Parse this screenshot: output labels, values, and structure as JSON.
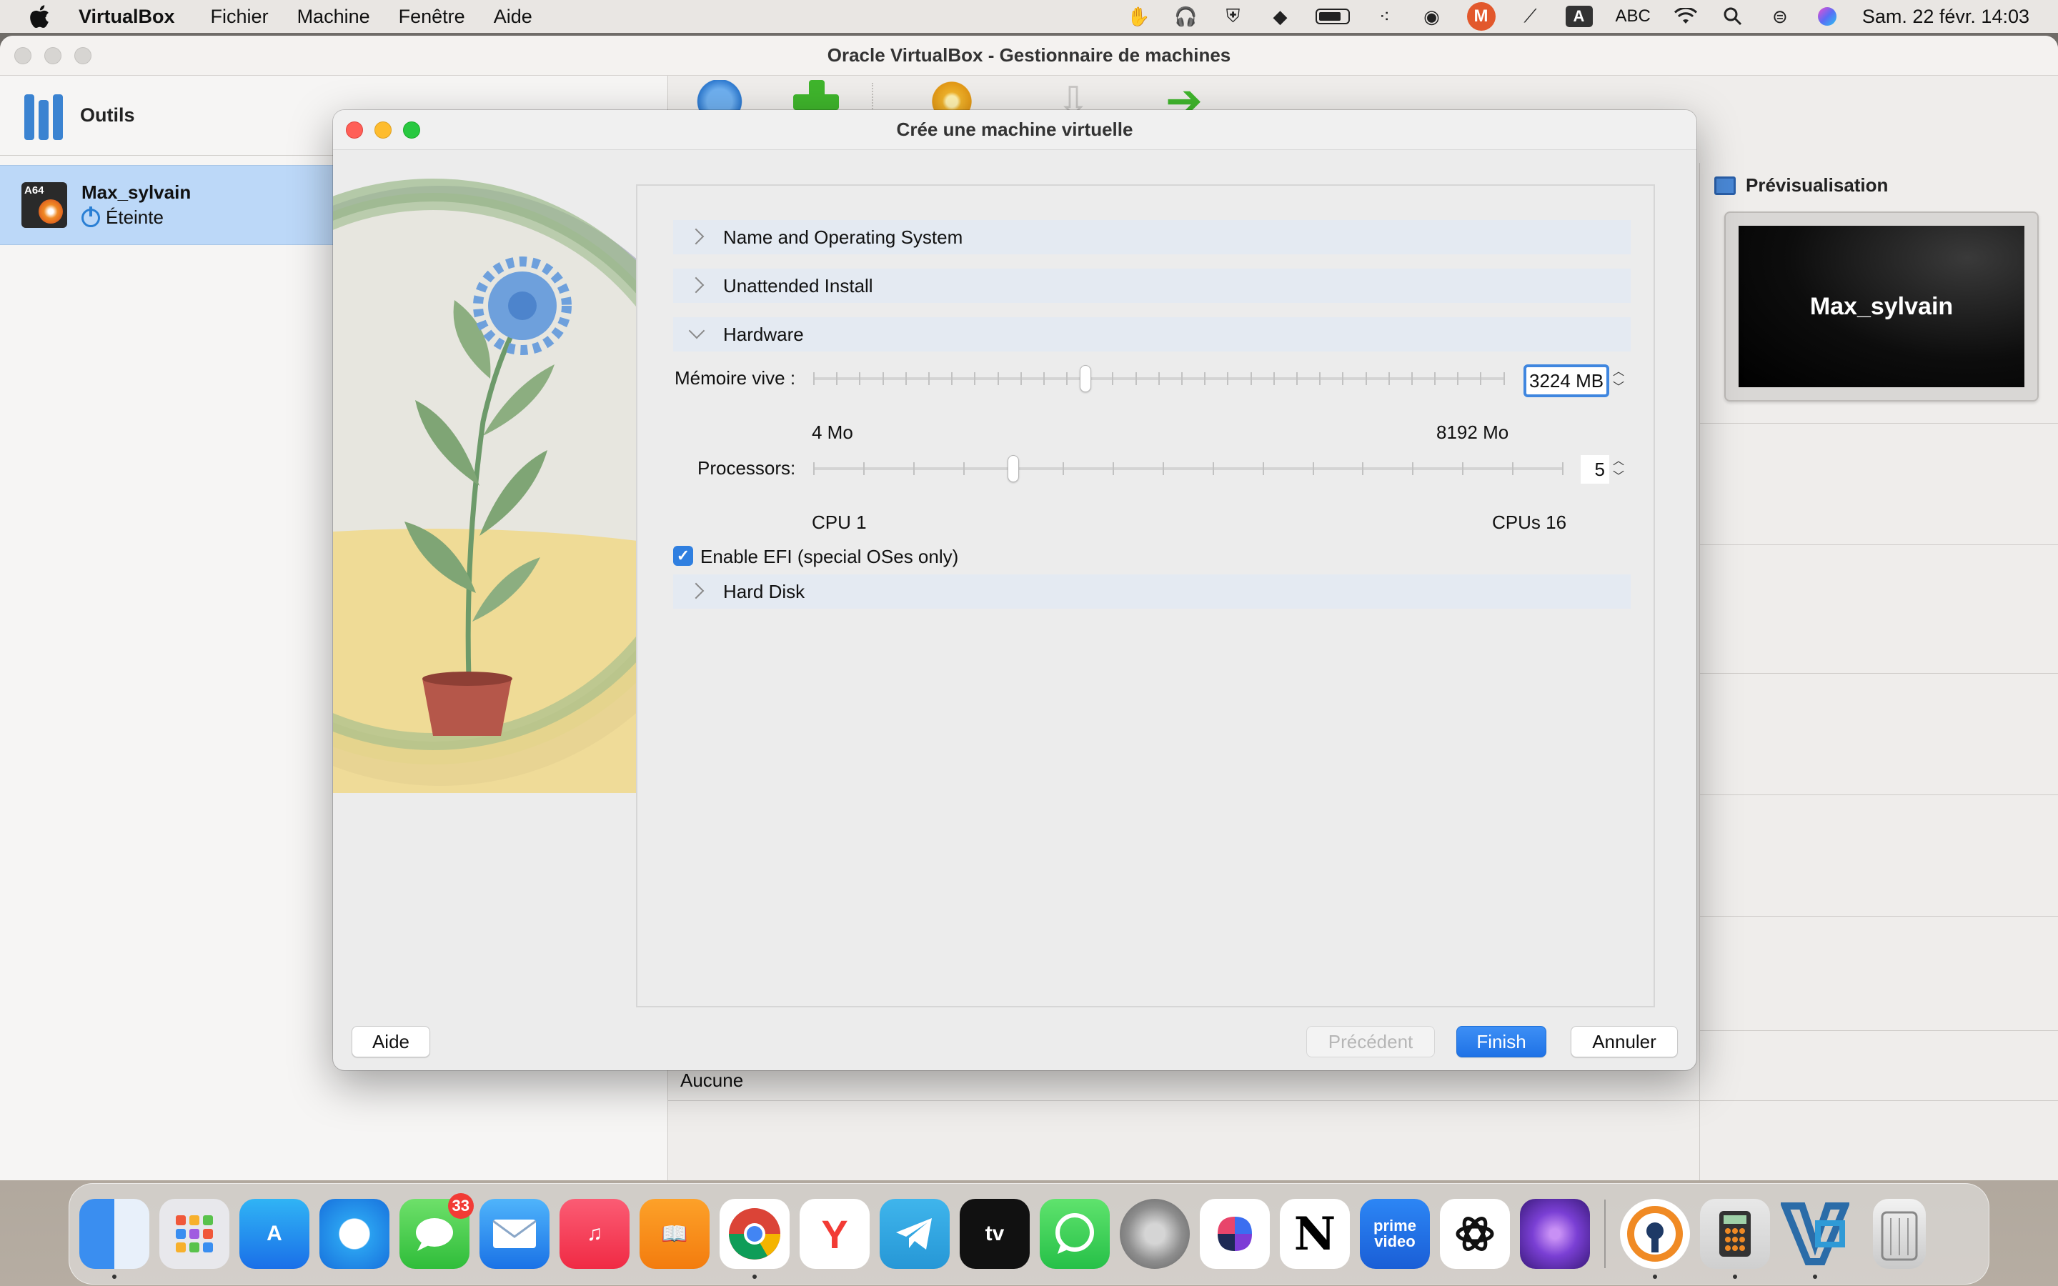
{
  "menubar": {
    "app_name": "VirtualBox",
    "items": [
      "Fichier",
      "Machine",
      "Fenêtre",
      "Aide"
    ],
    "input_source": "A",
    "input_label": "ABC",
    "clock": "Sam. 22 févr.  14:03"
  },
  "main_window": {
    "title": "Oracle VirtualBox - Gestionnaire de machines",
    "tools_label": "Outils",
    "vm": {
      "name": "Max_sylvain",
      "state": "Éteinte",
      "badge": "A64"
    },
    "preview_title": "Prévisualisation",
    "preview_vm_name": "Max_sylvain",
    "details_value": "Aucune"
  },
  "dialog": {
    "title": "Crée une machine virtuelle",
    "sections": {
      "name_os": "Name and Operating System",
      "unattended": "Unattended Install",
      "hardware": "Hardware",
      "hard_disk": "Hard Disk"
    },
    "memory": {
      "label": "Mémoire vive :",
      "value": "3224 MB",
      "min_label": "4 Mo",
      "max_label": "8192 Mo",
      "min": 4,
      "max": 8192,
      "current": 3224
    },
    "processors": {
      "label": "Processors:",
      "value": "5",
      "min_label": "CPU 1",
      "max_label": "CPUs 16",
      "min": 1,
      "max": 16,
      "current": 5
    },
    "efi": {
      "label": "Enable EFI (special OSes only)",
      "checked": true
    },
    "buttons": {
      "help": "Aide",
      "previous": "Précédent",
      "finish": "Finish",
      "cancel": "Annuler"
    }
  },
  "dock": {
    "messages_badge": "33",
    "apps": [
      "finder",
      "launchpad",
      "app-store",
      "safari",
      "messages",
      "mail",
      "music",
      "books",
      "chrome",
      "yandex",
      "telegram",
      "apple-tv",
      "whatsapp",
      "system-settings",
      "craft",
      "notion",
      "prime-video",
      "chatgpt",
      "tor-browser",
      "openvpn",
      "calculator",
      "virtualbox",
      "trash"
    ],
    "labels": {
      "apple_tv": "tv",
      "prime": "prime video"
    }
  },
  "colors": {
    "accent": "#1f72e6",
    "selection": "#bcd8f8",
    "section_bg": "#e4eaf2"
  }
}
